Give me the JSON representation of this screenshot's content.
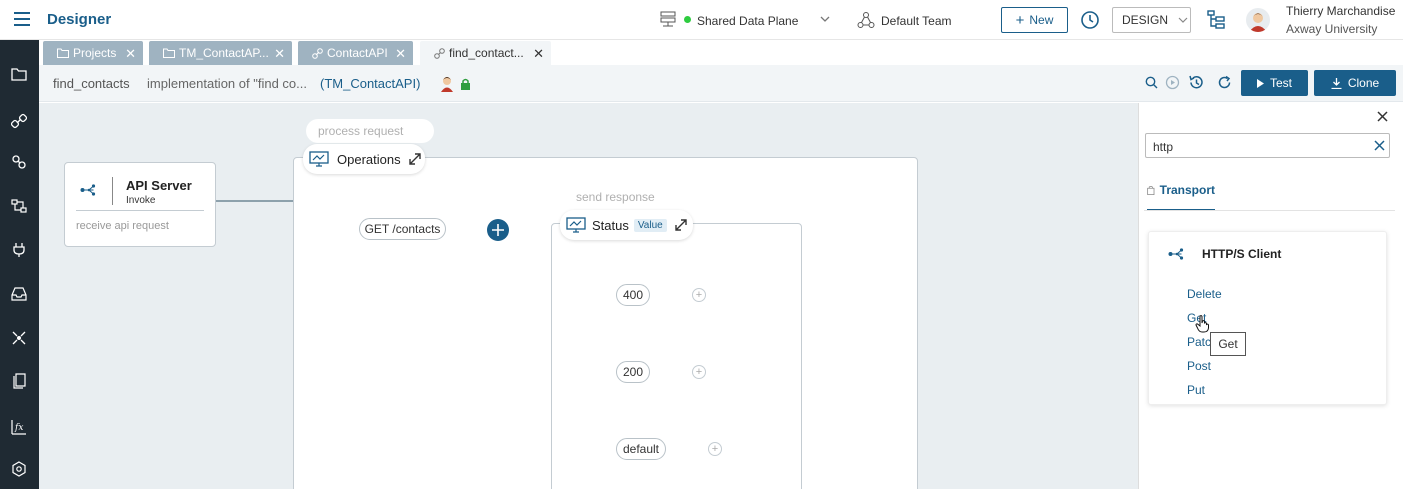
{
  "header": {
    "app_title": "Designer",
    "data_plane": "Shared Data Plane",
    "team": "Default Team",
    "new_label": "New",
    "mode": "DESIGN",
    "user_name": "Thierry Marchandise",
    "user_org": "Axway University"
  },
  "tabs": [
    {
      "label": "Projects",
      "icon": "folder-icon"
    },
    {
      "label": "TM_ContactAP...",
      "icon": "folder-icon"
    },
    {
      "label": "ContactAPI",
      "icon": "link-icon"
    },
    {
      "label": "find_contact...",
      "icon": "flow-icon"
    }
  ],
  "subheader": {
    "name": "find_contacts",
    "description": "implementation of \"find co...",
    "project_link": "(TM_ContactAPI)",
    "test_label": "Test",
    "clone_label": "Clone"
  },
  "canvas": {
    "api_server": {
      "title": "API Server",
      "subtitle": "Invoke",
      "footer": "receive api request"
    },
    "operations": {
      "hint": "process request",
      "label": "Operations"
    },
    "route": "GET /contacts",
    "status": {
      "hint": "send response",
      "label": "Status",
      "badge": "Value"
    },
    "branches": [
      "400",
      "200",
      "default"
    ]
  },
  "panel": {
    "search_value": "http",
    "category": "Transport",
    "card_title": "HTTP/S Client",
    "actions": [
      "Delete",
      "Get",
      "Patch",
      "Post",
      "Put"
    ],
    "tooltip": "Get"
  },
  "colors": {
    "accent": "#1a5e8a",
    "rail": "#1f2a33",
    "status_dot": "#2ecc40"
  }
}
